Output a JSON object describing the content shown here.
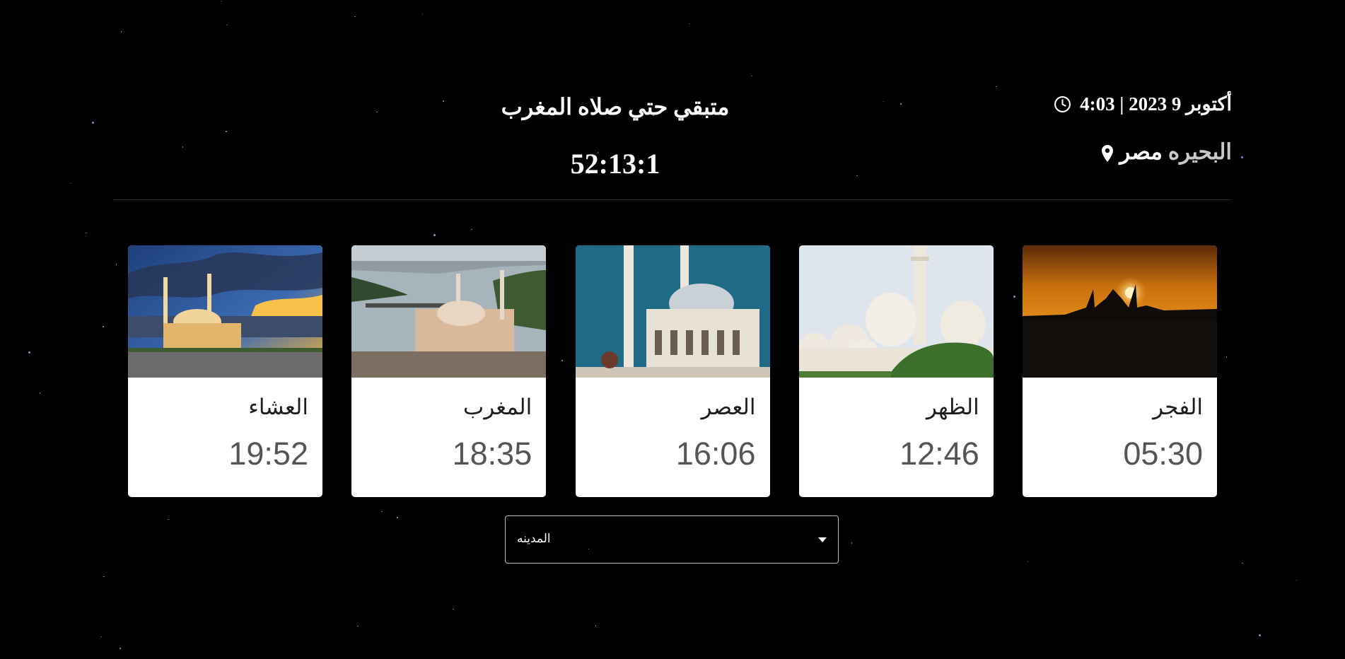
{
  "header": {
    "datetime_text": "أكتوبر 9 2023 | 4:03",
    "location_region": "البحيره",
    "location_country": "مصر",
    "clock_icon": "clock-icon",
    "pin_icon": "map-pin-icon"
  },
  "countdown": {
    "title": "متبقي حتي صلاه المغرب",
    "value": "52:13:1"
  },
  "prayers": [
    {
      "name": "الفجر",
      "time": "05:30"
    },
    {
      "name": "الظهر",
      "time": "12:46"
    },
    {
      "name": "العصر",
      "time": "16:06"
    },
    {
      "name": "المغرب",
      "time": "18:35"
    },
    {
      "name": "العشاء",
      "time": "19:52"
    }
  ],
  "city_select": {
    "label": "المدينه",
    "caret_icon": "caret-down-icon"
  },
  "colors": {
    "background": "#000000",
    "card": "#ffffff",
    "time_text": "#555555",
    "region_text": "#c9c9c9"
  }
}
